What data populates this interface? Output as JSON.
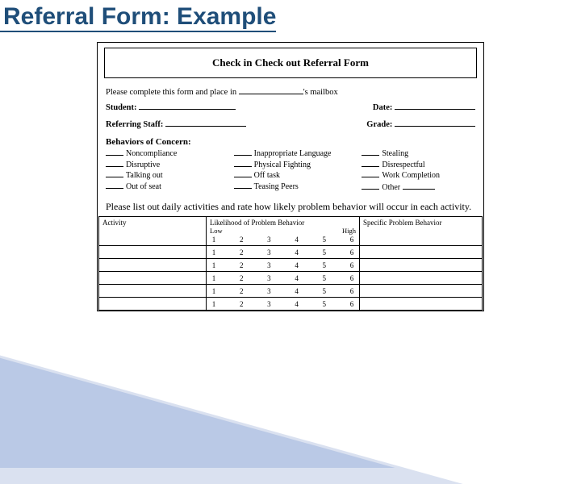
{
  "slide": {
    "title": "Referral Form: Example"
  },
  "form": {
    "title": "Check in Check out Referral Form",
    "intro_prefix": "Please complete this form and place in ",
    "intro_suffix": "'s mailbox",
    "fields": {
      "student": "Student:",
      "date": "Date:",
      "referring_staff": "Referring Staff:",
      "grade": "Grade:"
    },
    "behaviors": {
      "heading": "Behaviors of Concern:",
      "col1": [
        "Noncompliance",
        "Disruptive",
        "Talking out",
        "Out of seat"
      ],
      "col2": [
        "Inappropriate Language",
        "Physical Fighting",
        "Off task",
        "Teasing Peers"
      ],
      "col3": [
        "Stealing",
        "Disrespectful",
        "Work Completion",
        "Other"
      ]
    },
    "table": {
      "instruction": "Please list out daily activities and rate how likely problem behavior will occur in each activity.",
      "headers": {
        "activity": "Activity",
        "likelihood": "Likelihood of Problem Behavior",
        "low": "Low",
        "high": "High",
        "specific": "Specific Problem Behavior"
      },
      "scale": [
        "1",
        "2",
        "3",
        "4",
        "5",
        "6"
      ],
      "rows": 5
    }
  }
}
